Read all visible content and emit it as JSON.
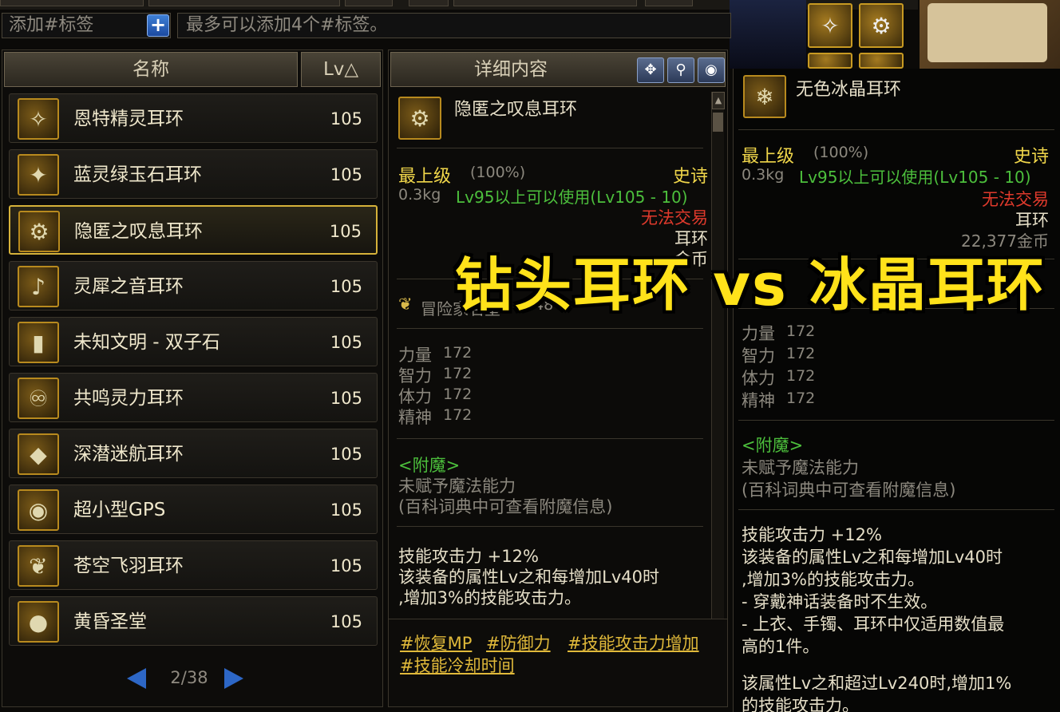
{
  "tags": {
    "input_placeholder": "添加#标签",
    "add_button": "+",
    "hint": "最多可以添加4个#标签。"
  },
  "list": {
    "header_name": "名称",
    "header_lv": "Lv△",
    "items": [
      {
        "name": "恩特精灵耳环",
        "lv": "105",
        "icon": "elf-earring-icon",
        "glyph": "✧"
      },
      {
        "name": "蓝灵绿玉石耳环",
        "lv": "105",
        "icon": "jade-earring-icon",
        "glyph": "✦"
      },
      {
        "name": "隐匿之叹息耳环",
        "lv": "105",
        "icon": "drill-earring-icon",
        "glyph": "⚙",
        "selected": true
      },
      {
        "name": "灵犀之音耳环",
        "lv": "105",
        "icon": "sound-earring-icon",
        "glyph": "♪"
      },
      {
        "name": "未知文明 - 双子石",
        "lv": "105",
        "icon": "twin-stone-icon",
        "glyph": "▮"
      },
      {
        "name": "共鸣灵力耳环",
        "lv": "105",
        "icon": "resonance-earring-icon",
        "glyph": "♾"
      },
      {
        "name": "深潜迷航耳环",
        "lv": "105",
        "icon": "dive-earring-icon",
        "glyph": "◆"
      },
      {
        "name": "超小型GPS",
        "lv": "105",
        "icon": "gps-icon",
        "glyph": "◉"
      },
      {
        "name": "苍空飞羽耳环",
        "lv": "105",
        "icon": "feather-earring-icon",
        "glyph": "❦"
      },
      {
        "name": "黄昏圣堂",
        "lv": "105",
        "icon": "twilight-temple-icon",
        "glyph": "●"
      }
    ],
    "page": "2/38"
  },
  "detail": {
    "title": "详细内容",
    "item_name": "隐匿之叹息耳环",
    "grade": "最上级",
    "grade_pct": "(100%)",
    "rarity": "史诗",
    "weight": "0.3kg",
    "level_req": "Lv95以上可以使用(Lv105 - 10)",
    "tradable": "无法交易",
    "slot": "耳环",
    "price": "金币",
    "fame": "冒险家名望",
    "fame_value": "748",
    "stats": [
      {
        "label": "力量",
        "value": "172"
      },
      {
        "label": "智力",
        "value": "172"
      },
      {
        "label": "体力",
        "value": "172"
      },
      {
        "label": "精神",
        "value": "172"
      }
    ],
    "enchant_title": "<附魔>",
    "enchant_none": "未赋予魔法能力",
    "enchant_hint": "(百科词典中可查看附魔信息)",
    "skill_line1": "技能攻击力 +12%",
    "skill_line2": "该装备的属性Lv之和每增加Lv40时",
    "skill_line3": ",增加3%的技能攻击力。",
    "tag_links": [
      "#恢复MP",
      "#防御力",
      "#技能攻击力增加",
      "#技能冷却时间"
    ]
  },
  "tooltip": {
    "item_name": "无色冰晶耳环",
    "grade": "最上级",
    "grade_pct": "(100%)",
    "rarity": "史诗",
    "weight": "0.3kg",
    "level_req": "Lv95以上可以使用(Lv105 - 10)",
    "tradable": "无法交易",
    "slot": "耳环",
    "price": "22,377金币",
    "fame_partial": "冒",
    "stats": [
      {
        "label": "力量",
        "value": "172"
      },
      {
        "label": "智力",
        "value": "172"
      },
      {
        "label": "体力",
        "value": "172"
      },
      {
        "label": "精神",
        "value": "172"
      }
    ],
    "enchant_title": "<附魔>",
    "enchant_none": "未赋予魔法能力",
    "enchant_hint": "(百科词典中可查看附魔信息)",
    "skill_lines": [
      "技能攻击力 +12%",
      "该装备的属性Lv之和每增加Lv40时",
      ",增加3%的技能攻击力。",
      "- 穿戴神话装备时不生效。",
      "- 上衣、手镯、耳环中仅适用数值最",
      "高的1件。",
      "该属性Lv之和超过Lv240时,增加1%",
      "的技能攻击力。"
    ]
  },
  "overlay_title": "钻头耳环 vs 冰晶耳环"
}
